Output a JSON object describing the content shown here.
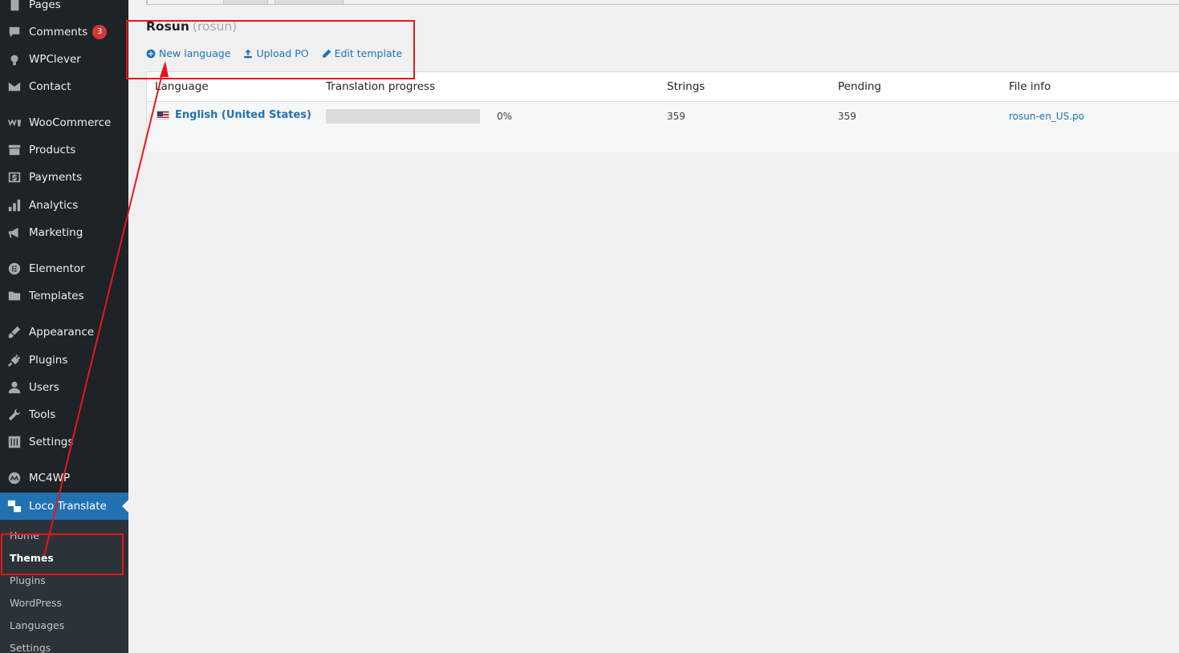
{
  "sidebar": {
    "items": [
      {
        "label": "Pages",
        "icon": "pages-icon"
      },
      {
        "label": "Comments",
        "icon": "comments-icon",
        "badge": "3"
      },
      {
        "label": "WPClever",
        "icon": "wpclever-icon"
      },
      {
        "label": "Contact",
        "icon": "envelope-icon"
      },
      {
        "label": "WooCommerce",
        "icon": "woocommerce-icon"
      },
      {
        "label": "Products",
        "icon": "archive-icon"
      },
      {
        "label": "Payments",
        "icon": "dollar-icon"
      },
      {
        "label": "Analytics",
        "icon": "bar-chart-icon"
      },
      {
        "label": "Marketing",
        "icon": "megaphone-icon"
      },
      {
        "label": "Elementor",
        "icon": "elementor-icon"
      },
      {
        "label": "Templates",
        "icon": "folder-icon"
      },
      {
        "label": "Appearance",
        "icon": "paintbrush-icon"
      },
      {
        "label": "Plugins",
        "icon": "plugin-icon"
      },
      {
        "label": "Users",
        "icon": "user-icon"
      },
      {
        "label": "Tools",
        "icon": "wrench-icon"
      },
      {
        "label": "Settings",
        "icon": "sliders-icon"
      },
      {
        "label": "MC4WP",
        "icon": "mc4wp-icon"
      },
      {
        "label": "Loco Translate",
        "icon": "translate-icon"
      }
    ],
    "submenu": [
      "Home",
      "Themes",
      "Plugins",
      "WordPress",
      "Languages",
      "Settings"
    ],
    "active_submenu": "Themes"
  },
  "project": {
    "title": "Rosun",
    "slug": "(rosun)"
  },
  "actions": [
    {
      "label": "New language",
      "icon": "plus-circle-icon"
    },
    {
      "label": "Upload PO",
      "icon": "upload-icon"
    },
    {
      "label": "Edit template",
      "icon": "pencil-icon"
    }
  ],
  "table": {
    "headers": [
      "Language",
      "Translation progress",
      "Strings",
      "Pending",
      "File info"
    ],
    "rows": [
      {
        "language": "English (United States)",
        "flag": "us-flag",
        "progress_percent": 0,
        "progress_label": "0%",
        "strings": "359",
        "pending": "359",
        "file": "rosun-en_US.po"
      }
    ]
  },
  "colors": {
    "sidebar_bg": "#1d2327",
    "accent": "#2271b1",
    "annotation": "#e8161b"
  }
}
